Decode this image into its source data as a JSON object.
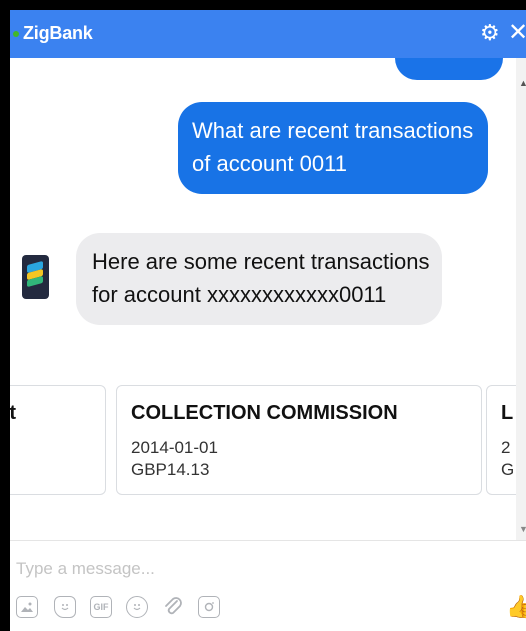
{
  "header": {
    "title": "ZigBank",
    "gear_glyph": "⚙",
    "close_glyph": "✕",
    "accent": "#3b82f0"
  },
  "messages": [
    {
      "sender": "user",
      "text": "What are recent transactions of account 0011"
    },
    {
      "sender": "bot",
      "text": "Here are some recent transactions for account xxxxxxxxxxxx0011"
    }
  ],
  "carousel": {
    "left_card": {
      "title_fragment": "ent"
    },
    "main_card": {
      "title": "COLLECTION COMMISSION",
      "date": "2014-01-01",
      "amount": "GBP14.13"
    },
    "right_card": {
      "title_fragment": "L",
      "date_fragment": "2",
      "amount_fragment": "G"
    }
  },
  "composer": {
    "placeholder": "Type a message...",
    "tools": [
      "image-icon",
      "sticker-icon",
      "gif-icon",
      "emoji-icon",
      "attachment-icon",
      "camera-icon"
    ],
    "gif_label": "GIF"
  },
  "like_glyph": "👍"
}
